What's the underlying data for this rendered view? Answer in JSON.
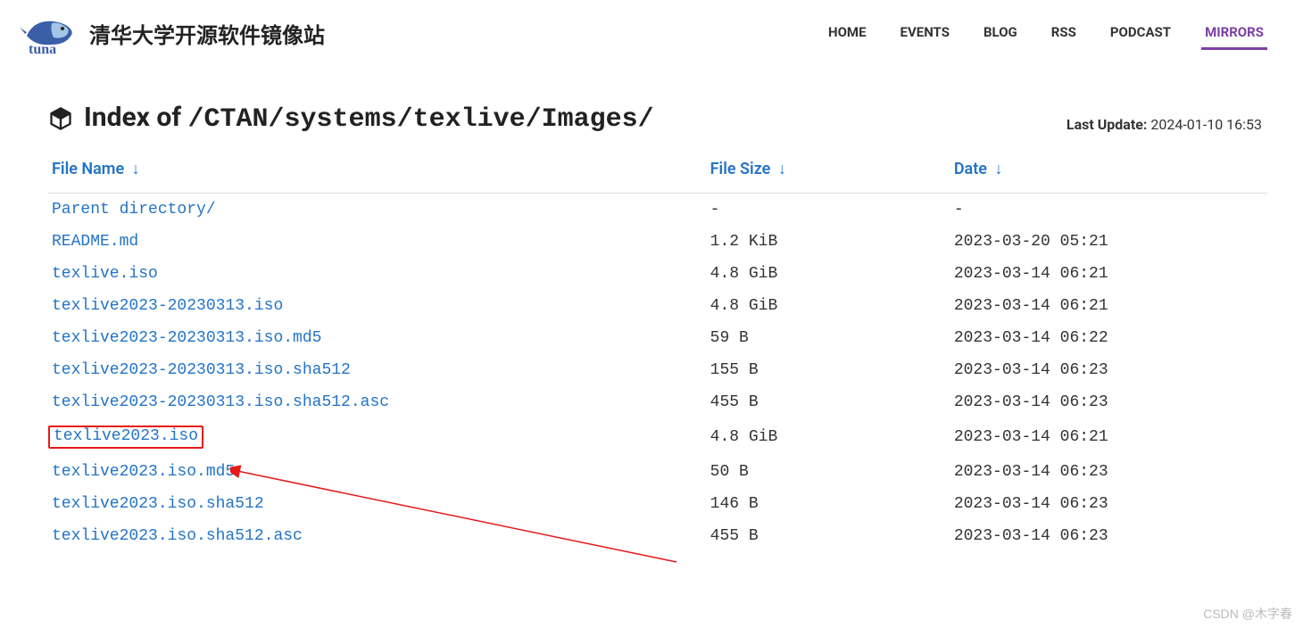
{
  "site": {
    "title": "清华大学开源软件镜像站"
  },
  "nav": {
    "items": [
      {
        "label": "HOME",
        "active": false
      },
      {
        "label": "EVENTS",
        "active": false
      },
      {
        "label": "BLOG",
        "active": false
      },
      {
        "label": "RSS",
        "active": false
      },
      {
        "label": "PODCAST",
        "active": false
      },
      {
        "label": "MIRRORS",
        "active": true
      }
    ]
  },
  "page": {
    "index_prefix": "Index of ",
    "index_path": "/CTAN/systems/texlive/Images/",
    "last_update_label": "Last Update:",
    "last_update_value": "2024-01-10 16:53"
  },
  "table": {
    "headers": {
      "name": "File Name",
      "size": "File Size",
      "date": "Date"
    },
    "rows": [
      {
        "name": "Parent directory/",
        "size": "-",
        "date": "-",
        "highlight": false
      },
      {
        "name": "README.md",
        "size": "1.2 KiB",
        "date": "2023-03-20 05:21",
        "highlight": false
      },
      {
        "name": "texlive.iso",
        "size": "4.8 GiB",
        "date": "2023-03-14 06:21",
        "highlight": false
      },
      {
        "name": "texlive2023-20230313.iso",
        "size": "4.8 GiB",
        "date": "2023-03-14 06:21",
        "highlight": false
      },
      {
        "name": "texlive2023-20230313.iso.md5",
        "size": "59 B",
        "date": "2023-03-14 06:22",
        "highlight": false
      },
      {
        "name": "texlive2023-20230313.iso.sha512",
        "size": "155 B",
        "date": "2023-03-14 06:23",
        "highlight": false
      },
      {
        "name": "texlive2023-20230313.iso.sha512.asc",
        "size": "455 B",
        "date": "2023-03-14 06:23",
        "highlight": false
      },
      {
        "name": "texlive2023.iso",
        "size": "4.8 GiB",
        "date": "2023-03-14 06:21",
        "highlight": true
      },
      {
        "name": "texlive2023.iso.md5",
        "size": "50 B",
        "date": "2023-03-14 06:23",
        "highlight": false
      },
      {
        "name": "texlive2023.iso.sha512",
        "size": "146 B",
        "date": "2023-03-14 06:23",
        "highlight": false
      },
      {
        "name": "texlive2023.iso.sha512.asc",
        "size": "455 B",
        "date": "2023-03-14 06:23",
        "highlight": false
      }
    ]
  },
  "watermark": "CSDN @木字春"
}
